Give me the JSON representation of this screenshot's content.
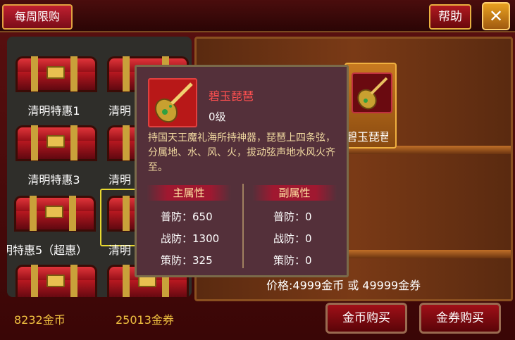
{
  "header": {
    "tab_title": "每周限购",
    "help_label": "帮助",
    "close_label": "✕"
  },
  "chests": [
    {
      "label": "清明特惠1"
    },
    {
      "label": "清明"
    },
    {
      "label": "清明特惠3"
    },
    {
      "label": "清明"
    },
    {
      "label": "明特惠5（超惠）"
    },
    {
      "label": "清明"
    },
    {
      "label": ""
    },
    {
      "label": ""
    }
  ],
  "shelf": {
    "item_name": "碧玉琵琶"
  },
  "tooltip": {
    "name": "碧玉琵琶",
    "level": "0级",
    "description": "持国天王魔礼海所持神器，琵琶上四条弦，分属地、水、风、火，拔动弦声地水风火齐至。",
    "main_title": "主属性",
    "sub_title": "副属性",
    "main_stats": [
      "普防：650",
      "战防：1300",
      "策防：325"
    ],
    "sub_stats": [
      "普防：0",
      "战防：0",
      "策防：0"
    ]
  },
  "purchase": {
    "price_text": "价格:4999金币 或 49999金券",
    "gold_amount": "8232金币",
    "coupon_amount": "25013金券",
    "buy_gold_label": "金币购买",
    "buy_coupon_label": "金券购买"
  },
  "icons": {
    "instrument": "pipa-icon",
    "chest": "treasure-chest-icon"
  },
  "colors": {
    "item_name": "#ff5050",
    "currency": "#f0c040",
    "accent_border": "#e8b040"
  }
}
